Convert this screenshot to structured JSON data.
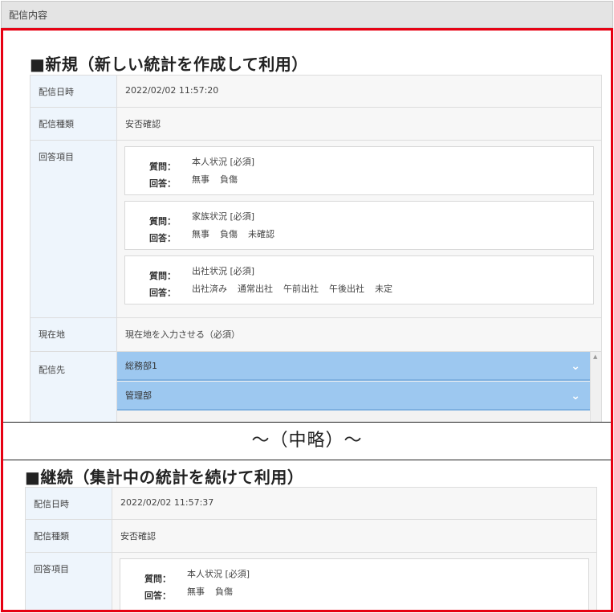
{
  "header": {
    "title": "配信内容"
  },
  "labels": {
    "date": "配信日時",
    "type": "配信種類",
    "answers": "回答項目",
    "location": "現在地",
    "destination": "配信先",
    "question_key": "質問：",
    "answer_key": "回答："
  },
  "omitted_text": "～（中略）～",
  "section1": {
    "title": "■新規（新しい統計を作成して利用）",
    "date": "2022/02/02 11:57:20",
    "type": "安否確認",
    "qa": [
      {
        "question": "本人状況 [必須]",
        "answers": [
          "無事",
          "負傷"
        ]
      },
      {
        "question": "家族状況 [必須]",
        "answers": [
          "無事",
          "負傷",
          "未確認"
        ]
      },
      {
        "question": "出社状況 [必須]",
        "answers": [
          "出社済み",
          "通常出社",
          "午前出社",
          "午後出社",
          "未定"
        ]
      }
    ],
    "location": "現在地を入力させる（必須）",
    "destinations": [
      "総務部1",
      "管理部"
    ]
  },
  "section2": {
    "title": "■継続（集計中の統計を続けて利用）",
    "date": "2022/02/02 11:57:37",
    "type": "安否確認",
    "qa": [
      {
        "question": "本人状況 [必須]",
        "answers": [
          "無事",
          "負傷"
        ]
      }
    ]
  }
}
